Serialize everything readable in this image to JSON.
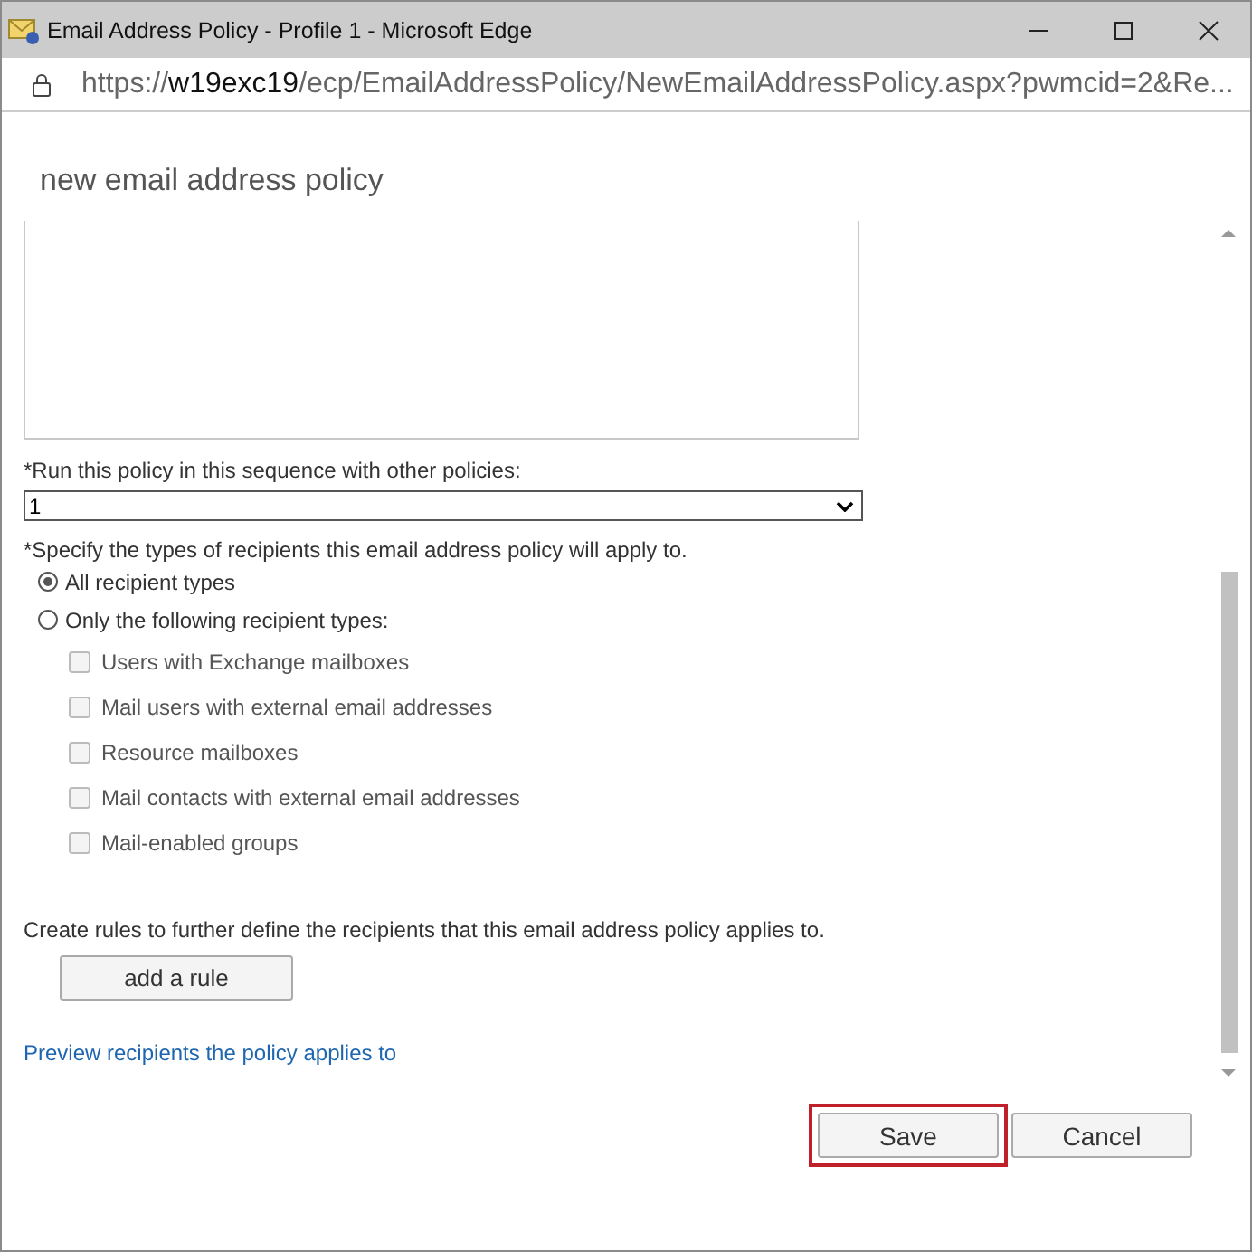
{
  "window": {
    "title": "Email Address Policy - Profile 1 - Microsoft Edge"
  },
  "address_bar": {
    "url_host": "w19exc19",
    "url_prefix": "https://",
    "url_rest": "/ecp/EmailAddressPolicy/NewEmailAddressPolicy.aspx?pwmcid=2&Re..."
  },
  "heading": "new email address policy",
  "sequence": {
    "label": "*Run this policy in this sequence with other policies:",
    "value": "1"
  },
  "recipients": {
    "label": "*Specify the types of recipients this email address policy will apply to.",
    "options": [
      {
        "label": "All recipient types",
        "selected": true
      },
      {
        "label": "Only the following recipient types:",
        "selected": false
      }
    ],
    "types": [
      {
        "label": "Users with Exchange mailboxes",
        "checked": false,
        "disabled": true
      },
      {
        "label": "Mail users with external email addresses",
        "checked": false,
        "disabled": true
      },
      {
        "label": "Resource mailboxes",
        "checked": false,
        "disabled": true
      },
      {
        "label": "Mail contacts with external email addresses",
        "checked": false,
        "disabled": true
      },
      {
        "label": "Mail-enabled groups",
        "checked": false,
        "disabled": true
      }
    ]
  },
  "rules": {
    "text": "Create rules to further define the recipients that this email address policy applies to.",
    "button": "add a rule"
  },
  "preview_link": "Preview recipients the policy applies to",
  "buttons": [
    {
      "label": "Save",
      "highlighted": true
    },
    {
      "label": "Cancel",
      "highlighted": false
    }
  ]
}
